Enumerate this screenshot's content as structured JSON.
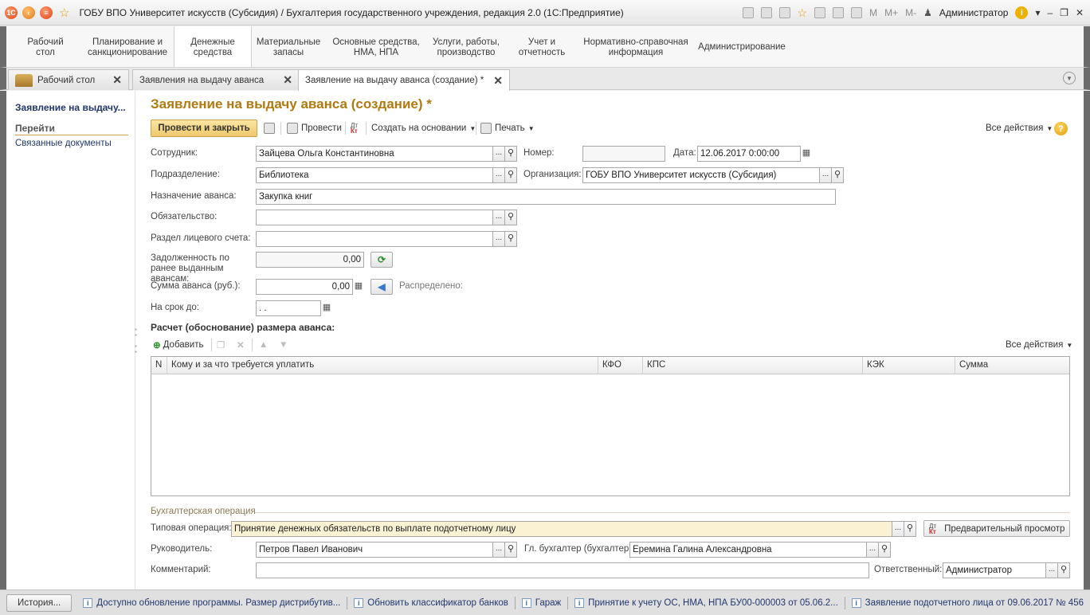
{
  "window": {
    "title": "ГОБУ ВПО Университет искусств (Субсидия) / Бухгалтерия государственного учреждения, редакция 2.0  (1С:Предприятие)",
    "user": "Администратор",
    "calc_labels": [
      "M",
      "M+",
      "M-"
    ]
  },
  "sections": [
    {
      "label": "Рабочий стол"
    },
    {
      "label": "Планирование и санкционирование"
    },
    {
      "label": "Денежные средства"
    },
    {
      "label": "Материальные запасы"
    },
    {
      "label": "Основные средства, НМА, НПА"
    },
    {
      "label": "Услуги, работы, производство"
    },
    {
      "label": "Учет и отчетность"
    },
    {
      "label": "Нормативно-справочная информация"
    },
    {
      "label": "Администрирование"
    }
  ],
  "tabs": [
    {
      "label": "Рабочий стол"
    },
    {
      "label": "Заявления на выдачу аванса"
    },
    {
      "label": "Заявление на выдачу аванса (создание) *"
    }
  ],
  "nav": {
    "title": "Заявление на выдачу...",
    "go_label": "Перейти",
    "link": "Связанные документы"
  },
  "form": {
    "title": "Заявление на выдачу аванса (создание) *",
    "commands": {
      "post_close": "Провести и закрыть",
      "post": "Провести",
      "create_based": "Создать на основании",
      "print": "Печать",
      "all_actions": "Все действия"
    },
    "fields": {
      "employee_label": "Сотрудник:",
      "employee_value": "Зайцева Ольга Константиновна",
      "number_label": "Номер:",
      "number_value": "",
      "date_label": "Дата:",
      "date_value": "12.06.2017  0:00:00",
      "department_label": "Подразделение:",
      "department_value": "Библиотека",
      "org_label": "Организация:",
      "org_value": "ГОБУ ВПО Университет искусств (Субсидия)",
      "purpose_label": "Назначение аванса:",
      "purpose_value": "Закупка книг",
      "obligation_label": "Обязательство:",
      "obligation_value": "",
      "account_section_label": "Раздел лицевого счета:",
      "account_section_value": "",
      "debt_label": "Задолженность по ранее выданным авансам:",
      "debt_value": "0,00",
      "amount_label": "Сумма аванса (руб.):",
      "amount_value": "0,00",
      "distributed_label": "Распределено:",
      "term_label": "На срок до:",
      "term_value": " .  ."
    },
    "calc": {
      "title": "Расчет (обоснование) размера аванса:",
      "add": "Добавить",
      "all_actions": "Все действия",
      "columns": [
        "N",
        "Кому и за что требуется уплатить",
        "КФО",
        "КПС",
        "КЭК",
        "Сумма"
      ],
      "rows": []
    },
    "accounting": {
      "group_title": "Бухгалтерская операция",
      "op_label": "Типовая операция:",
      "op_value": "Принятие денежных обязательств по выплате подотчетному лицу",
      "preview": "Предварительный просмотр",
      "head_label": "Руководитель:",
      "head_value": "Петров Павел Иванович",
      "chief_acc_label": "Гл. бухгалтер (бухгалтер):",
      "chief_acc_value": "Еремина Галина Александровна",
      "comment_label": "Комментарий:",
      "comment_value": "",
      "responsible_label": "Ответственный:",
      "responsible_value": "Администратор"
    }
  },
  "status": {
    "history": "История...",
    "items": [
      "Доступно обновление программы. Размер дистрибутив...",
      "Обновить классификатор банков",
      "Гараж",
      "Принятие к учету ОС, НМА, НПА БУ00-000003 от 05.06.2...",
      "Заявление подотчетного лица от 09.06.2017 № 456"
    ]
  }
}
